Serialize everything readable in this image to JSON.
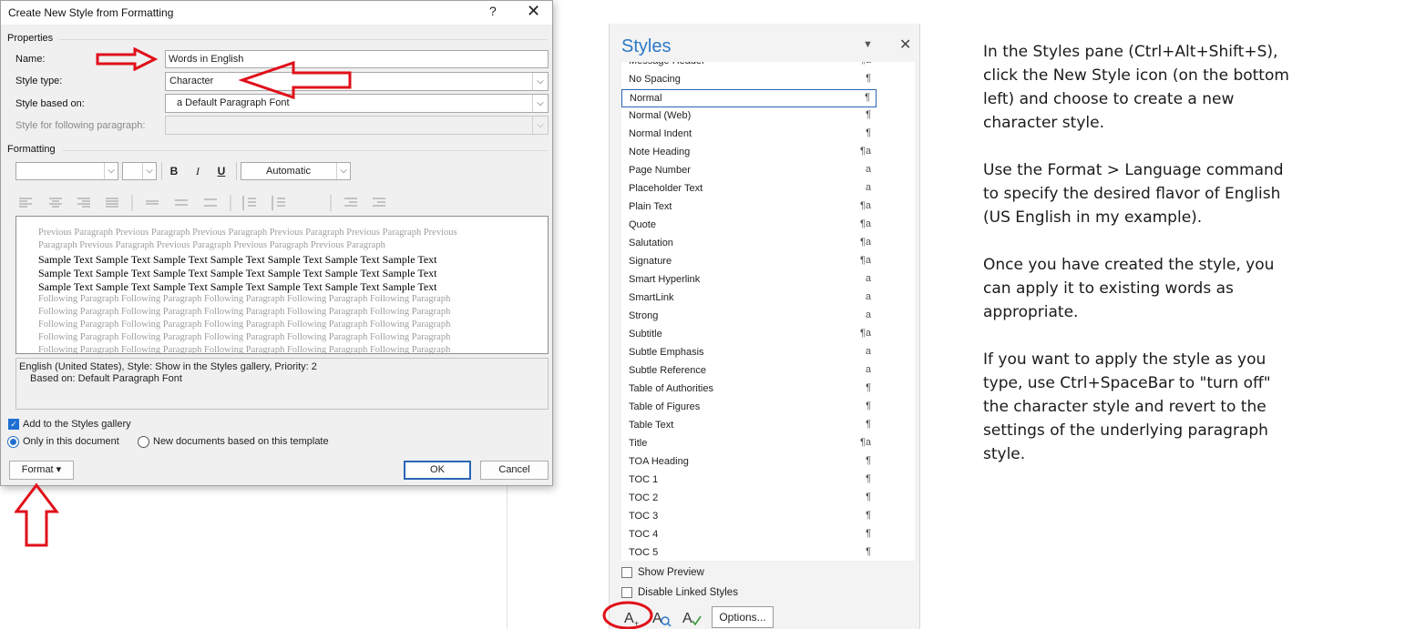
{
  "dialog": {
    "title": "Create New Style from Formatting",
    "help": "?",
    "close": "✕",
    "properties_label": "Properties",
    "name_label": "Name:",
    "name_value": "Words in English",
    "style_type_label": "Style type:",
    "style_type_value": "Character",
    "based_on_label": "Style based on:",
    "based_on_value": "a Default Paragraph Font",
    "following_label": "Style for following paragraph:",
    "following_value": "",
    "formatting_label": "Formatting",
    "font_value": "",
    "size_value": "",
    "bold": "B",
    "italic": "I",
    "underline": "U",
    "color_value": "Automatic",
    "preview": {
      "prev_lines": [
        "Previous Paragraph Previous Paragraph Previous Paragraph Previous Paragraph Previous Paragraph Previous",
        "Paragraph Previous Paragraph Previous Paragraph Previous Paragraph Previous Paragraph"
      ],
      "sample_lines": [
        "Sample Text Sample Text Sample Text Sample Text Sample Text Sample Text Sample Text",
        "Sample Text Sample Text Sample Text Sample Text Sample Text Sample Text Sample Text",
        "Sample Text Sample Text Sample Text Sample Text Sample Text Sample Text Sample Text"
      ],
      "following_lines": [
        "Following Paragraph Following Paragraph Following Paragraph Following Paragraph Following Paragraph",
        "Following Paragraph Following Paragraph Following Paragraph Following Paragraph Following Paragraph",
        "Following Paragraph Following Paragraph Following Paragraph Following Paragraph Following Paragraph",
        "Following Paragraph Following Paragraph Following Paragraph Following Paragraph Following Paragraph",
        "Following Paragraph Following Paragraph Following Paragraph Following Paragraph Following Paragraph"
      ]
    },
    "description_line1": "English (United States), Style: Show in the Styles gallery, Priority: 2",
    "description_line2": "Based on: Default Paragraph Font",
    "add_to_gallery": "Add to the Styles gallery",
    "only_this_doc": "Only in this document",
    "new_docs": "New documents based on this template",
    "format_button": "Format ▾",
    "ok_button": "OK",
    "cancel_button": "Cancel"
  },
  "styles_pane": {
    "title": "Styles",
    "dropdown": "▼",
    "close": "✕",
    "items": [
      {
        "name": "Message Header",
        "icon": "¶a"
      },
      {
        "name": "No Spacing",
        "icon": "¶"
      },
      {
        "name": "Normal",
        "icon": "¶"
      },
      {
        "name": "Normal (Web)",
        "icon": "¶"
      },
      {
        "name": "Normal Indent",
        "icon": "¶"
      },
      {
        "name": "Note Heading",
        "icon": "¶a"
      },
      {
        "name": "Page Number",
        "icon": "a"
      },
      {
        "name": "Placeholder Text",
        "icon": "a"
      },
      {
        "name": "Plain Text",
        "icon": "¶a"
      },
      {
        "name": "Quote",
        "icon": "¶a"
      },
      {
        "name": "Salutation",
        "icon": "¶a"
      },
      {
        "name": "Signature",
        "icon": "¶a"
      },
      {
        "name": "Smart Hyperlink",
        "icon": "a"
      },
      {
        "name": "SmartLink",
        "icon": "a"
      },
      {
        "name": "Strong",
        "icon": "a"
      },
      {
        "name": "Subtitle",
        "icon": "¶a"
      },
      {
        "name": "Subtle Emphasis",
        "icon": "a"
      },
      {
        "name": "Subtle Reference",
        "icon": "a"
      },
      {
        "name": "Table of Authorities",
        "icon": "¶"
      },
      {
        "name": "Table of Figures",
        "icon": "¶"
      },
      {
        "name": "Table Text",
        "icon": "¶"
      },
      {
        "name": "Title",
        "icon": "¶a"
      },
      {
        "name": "TOA Heading",
        "icon": "¶"
      },
      {
        "name": "TOC 1",
        "icon": "¶"
      },
      {
        "name": "TOC 2",
        "icon": "¶"
      },
      {
        "name": "TOC 3",
        "icon": "¶"
      },
      {
        "name": "TOC 4",
        "icon": "¶"
      },
      {
        "name": "TOC 5",
        "icon": "¶"
      }
    ],
    "selected": "Normal",
    "show_preview": "Show Preview",
    "disable_linked": "Disable Linked Styles",
    "options_button": "Options..."
  },
  "instructions": [
    "In the Styles pane (Ctrl+Alt+Shift+S), click the New Style icon (on the bottom left) and choose to create a new character style.",
    "Use the Format > Language command to specify the desired flavor of English (US English in my example).",
    "Once you have created the style, you can apply it to existing words as appropriate.",
    "If you want to apply the style as you type, use Ctrl+SpaceBar to \"turn off\" the character style and revert to the settings of the underlying paragraph style."
  ],
  "colors": {
    "accent": "#2b78c6",
    "annotation": "#e0101a",
    "selection_border": "#2b65b5"
  }
}
